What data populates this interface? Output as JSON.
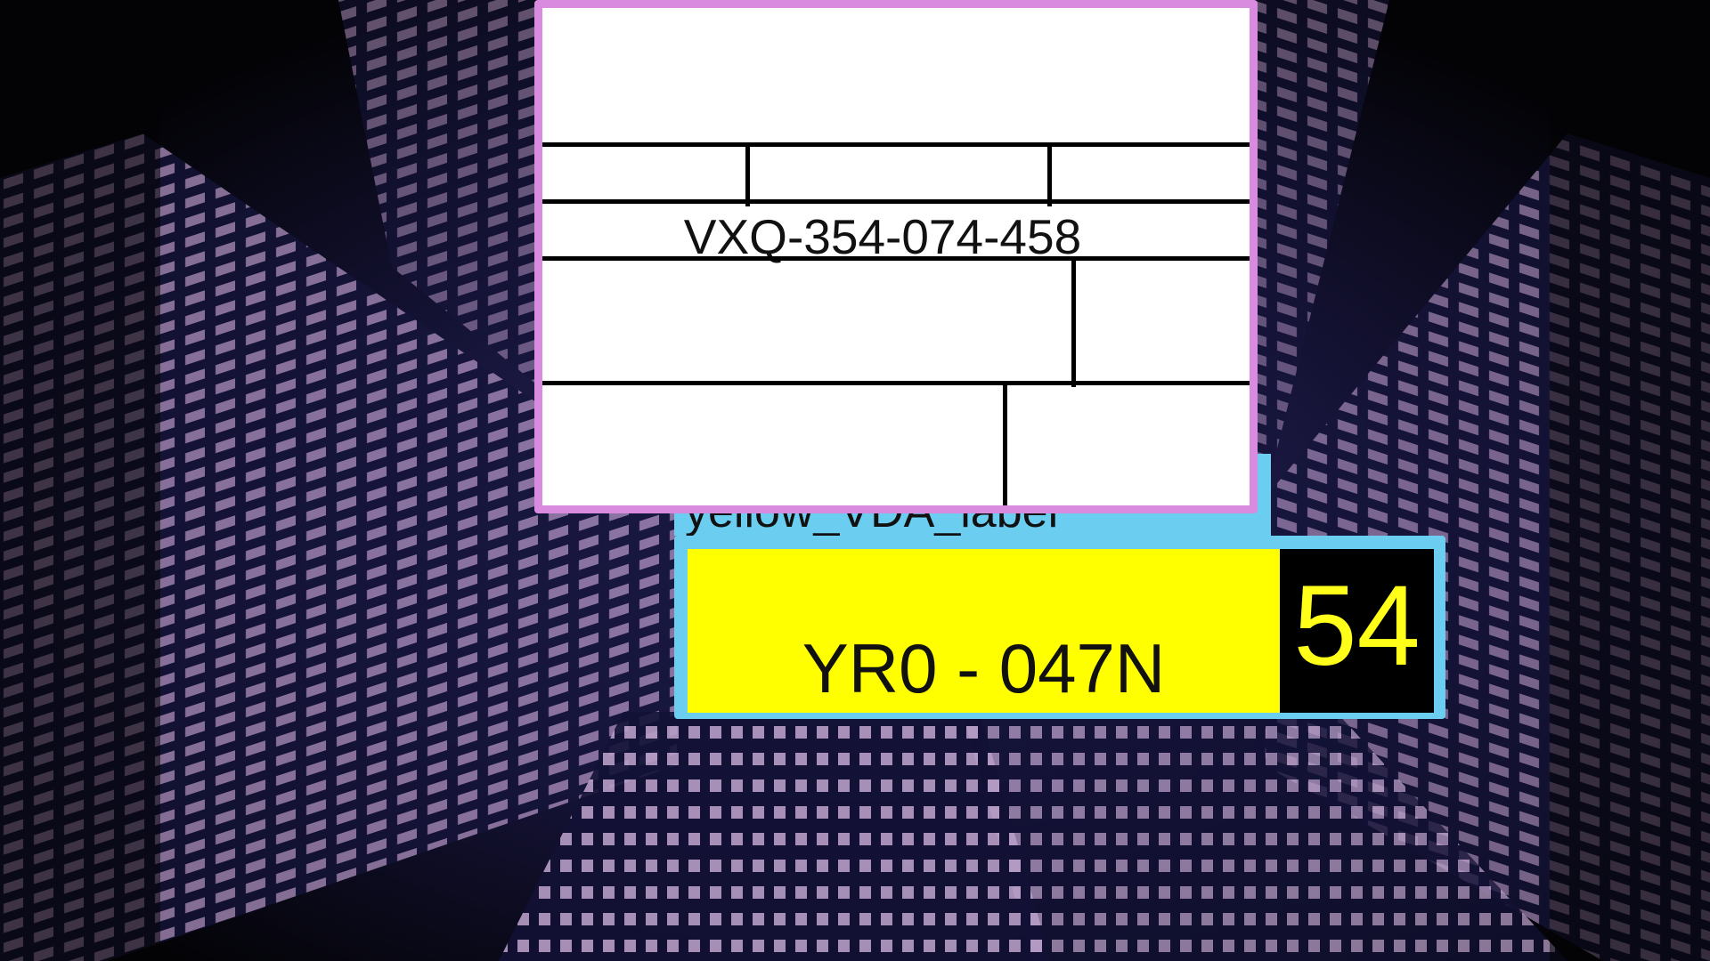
{
  "scene": {
    "background": "night-skyscrapers-looking-up",
    "colors": {
      "background_dark": "#050509",
      "window_glow": "#c9a6d6",
      "facade_blue": "#1b1a4a"
    }
  },
  "white_label": {
    "serial": "VXQ-354-074-458",
    "border_color": "#d98be0"
  },
  "caption_tab": {
    "text": "yellow_VDA_label",
    "color": "#6bcdf0"
  },
  "plate": {
    "code": "YR0 - 047N",
    "number": "54",
    "colors": {
      "plate": "#ffff00",
      "number_box": "#000000",
      "number_text": "#ffff1a",
      "frame": "#6bcdf0"
    }
  }
}
